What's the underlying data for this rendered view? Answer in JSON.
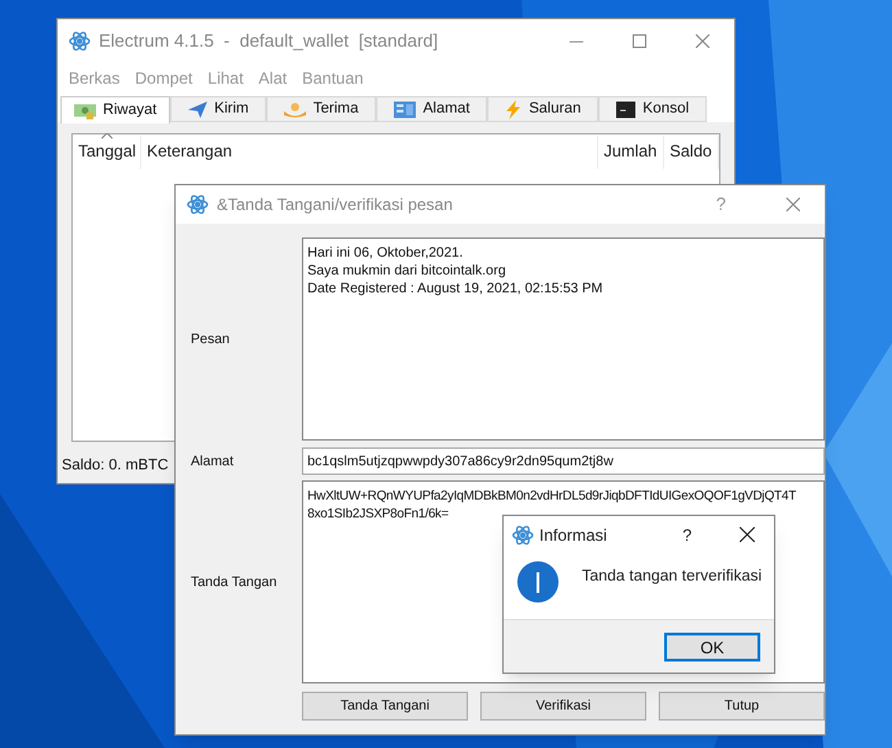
{
  "main_window": {
    "title": "Electrum 4.1.5  -  default_wallet  [standard]"
  },
  "menu": [
    "Berkas",
    "Dompet",
    "Lihat",
    "Alat",
    "Bantuan"
  ],
  "tabs": [
    {
      "label": "Riwayat",
      "selected": true
    },
    {
      "label": "Kirim",
      "selected": false
    },
    {
      "label": "Terima",
      "selected": false
    },
    {
      "label": "Alamat",
      "selected": false
    },
    {
      "label": "Saluran",
      "selected": false
    },
    {
      "label": "Konsol",
      "selected": false
    }
  ],
  "table": {
    "columns": [
      "Tanggal",
      "Keterangan",
      "Jumlah",
      "Saldo"
    ]
  },
  "status_bar": "Saldo: 0. mBTC",
  "sign_dialog": {
    "title": "&Tanda Tangani/verifikasi pesan",
    "help": "?",
    "message_label": "Pesan",
    "message_lines": [
      "Hari ini 06, Oktober,2021.",
      "Saya mukmin dari bitcointalk.org",
      "Date Registered : August 19, 2021, 02:15:53 PM"
    ],
    "address_label": "Alamat",
    "address": "bc1qslm5utjzqpwwpdy307a86cy9r2dn95qum2tj8w",
    "signature_label": "Tanda Tangan",
    "signature_lines": [
      "HwXltUW+RQnWYUPfa2yIqMDBkBM0n2vdHrDL5d9rJiqbDFTIdUIGexOQOF1gVDjQT4T",
      "8xo1SIb2JSXP8oFn1/6k="
    ],
    "buttons": [
      "Tanda Tangani",
      "Verifikasi",
      "Tutup"
    ]
  },
  "info_dialog": {
    "title": "Informasi",
    "help": "?",
    "message": "Tanda tangan terverifikasi",
    "button": "OK"
  }
}
